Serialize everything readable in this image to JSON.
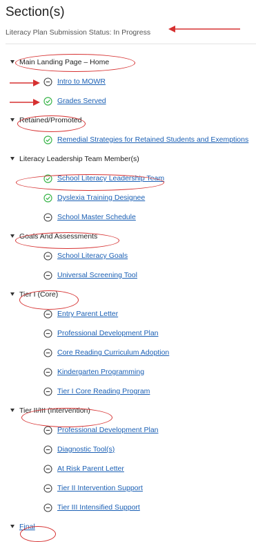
{
  "page": {
    "title": "Section(s)",
    "status": "Literacy Plan Submission Status: In Progress"
  },
  "colors": {
    "accent": "#1a5fb4",
    "check": "#3ab54a",
    "annotation": "#d63030"
  },
  "sections": [
    {
      "label": "Main Landing Page – Home",
      "items": [
        {
          "label": "Intro to MOWR",
          "status": "incomplete",
          "icon": "circle-minus-icon"
        },
        {
          "label": "Grades Served",
          "status": "complete",
          "icon": "check-circle-icon"
        }
      ]
    },
    {
      "label": "Retained/Promoted",
      "items": [
        {
          "label": "Remedial Strategies for Retained Students and Exemptions",
          "status": "complete",
          "icon": "check-circle-icon"
        }
      ]
    },
    {
      "label": "Literacy Leadership Team Member(s)",
      "items": [
        {
          "label": "School Literacy Leadership Team",
          "status": "complete",
          "icon": "check-circle-icon"
        },
        {
          "label": "Dyslexia Training Designee",
          "status": "complete",
          "icon": "check-circle-icon"
        },
        {
          "label": "School Master Schedule",
          "status": "incomplete",
          "icon": "circle-minus-icon"
        }
      ]
    },
    {
      "label": "Goals And Assessments",
      "items": [
        {
          "label": "School Literacy Goals",
          "status": "incomplete",
          "icon": "circle-minus-icon"
        },
        {
          "label": "Universal Screening Tool",
          "status": "incomplete",
          "icon": "circle-minus-icon"
        }
      ]
    },
    {
      "label": "Tier I (Core)",
      "items": [
        {
          "label": "Entry Parent Letter",
          "status": "incomplete",
          "icon": "circle-minus-icon"
        },
        {
          "label": "Professional Development Plan",
          "status": "incomplete",
          "icon": "circle-minus-icon"
        },
        {
          "label": "Core Reading Curriculum Adoption",
          "status": "incomplete",
          "icon": "circle-minus-icon"
        },
        {
          "label": "Kindergarten Programming",
          "status": "incomplete",
          "icon": "circle-minus-icon"
        },
        {
          "label": "Tier I Core Reading Program",
          "status": "incomplete",
          "icon": "circle-minus-icon"
        }
      ]
    },
    {
      "label": "Tier II/III (Intervention)",
      "items": [
        {
          "label": "Professional Development Plan",
          "status": "incomplete",
          "icon": "circle-minus-icon"
        },
        {
          "label": "Diagnostic Tool(s)",
          "status": "incomplete",
          "icon": "circle-minus-icon"
        },
        {
          "label": "At Risk Parent Letter",
          "status": "incomplete",
          "icon": "circle-minus-icon"
        },
        {
          "label": "Tier II Intervention Support",
          "status": "incomplete",
          "icon": "circle-minus-icon"
        },
        {
          "label": "Tier III Intensified Support",
          "status": "incomplete",
          "icon": "circle-minus-icon"
        }
      ]
    },
    {
      "label": "Final",
      "link": true,
      "items": []
    }
  ]
}
